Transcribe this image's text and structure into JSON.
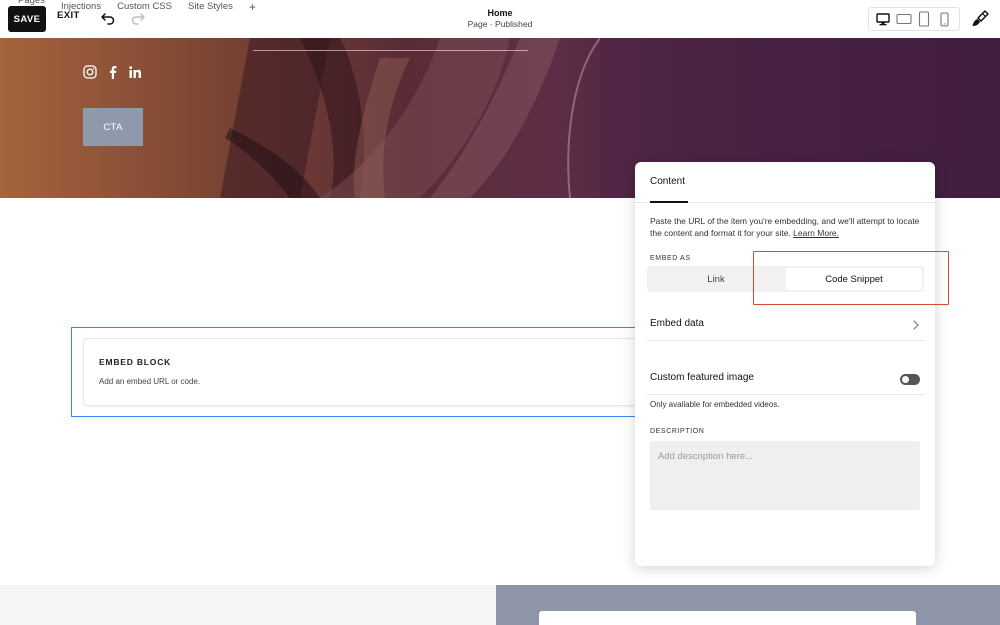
{
  "toolbar": {
    "tabs": [
      "Pages",
      "Injections",
      "Custom CSS",
      "Site Styles"
    ],
    "plus": "+",
    "save_label": "SAVE",
    "exit_label": "EXIT",
    "page_title": "Home",
    "page_status": "Page · Published",
    "devices": [
      "desktop-icon",
      "tablet-landscape-icon",
      "tablet-portrait-icon",
      "mobile-icon"
    ]
  },
  "hero": {
    "social_icons": [
      "instagram-icon",
      "facebook-icon",
      "linkedin-icon"
    ],
    "cta_label": "CTA"
  },
  "embed_block": {
    "title": "EMBED BLOCK",
    "subtitle": "Add an embed URL or code."
  },
  "panel": {
    "tab_label": "Content",
    "description": "Paste the URL of the item you're embedding, and we'll attempt to locate the content and format it for your site.",
    "learn_more": "Learn More.",
    "embed_as_label": "EMBED AS",
    "embed_as_options": [
      "Link",
      "Code Snippet"
    ],
    "embed_as_selected": "Code Snippet",
    "embed_data_label": "Embed data",
    "custom_featured_label": "Custom featured image",
    "custom_featured_on": false,
    "custom_featured_note": "Only available for embedded videos.",
    "description_label": "DESCRIPTION",
    "description_placeholder": "Add description here..."
  },
  "colors": {
    "highlight": "#d84a36",
    "selection": "#3b82f6",
    "cta": "#8e9aab"
  }
}
